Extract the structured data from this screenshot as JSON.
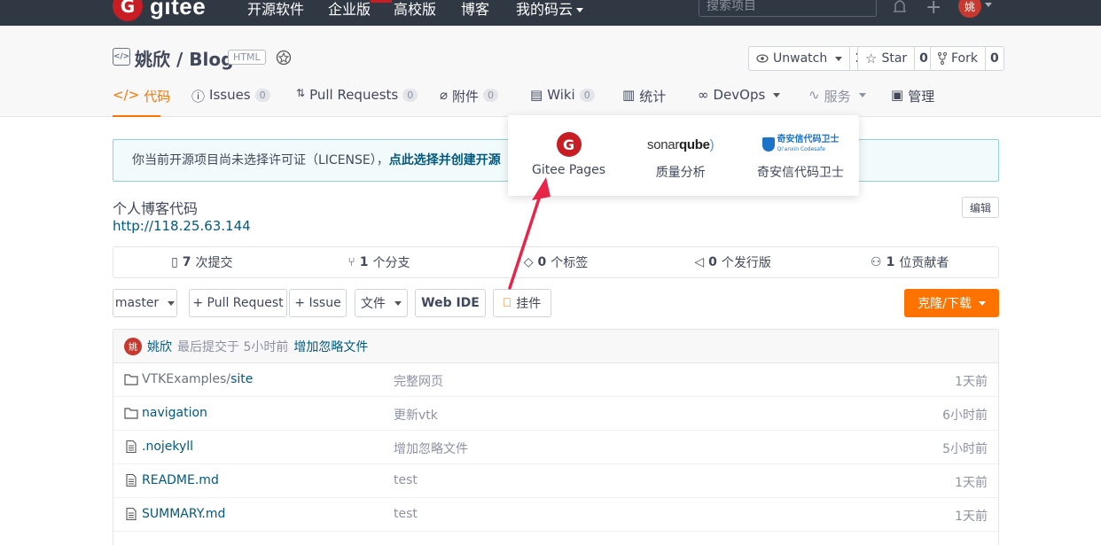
{
  "topnav": {
    "logo_text": "gitee",
    "logo_letter": "G",
    "links": [
      "开源软件",
      "企业版",
      "高校版",
      "博客",
      "我的码云"
    ],
    "search_placeholder": "搜索项目",
    "user_avatar": "姚"
  },
  "repo": {
    "owner_name": "姚欣 / Blog",
    "lang_tag": "HTML",
    "watch_label": "Unwatch",
    "watch_count": "1",
    "star_label": "Star",
    "star_count": "0",
    "fork_label": "Fork",
    "fork_count": "0"
  },
  "tabs": [
    {
      "label": "代码"
    },
    {
      "label": "Issues",
      "count": "0"
    },
    {
      "label": "Pull Requests",
      "count": "0"
    },
    {
      "label": "附件",
      "count": "0"
    },
    {
      "label": "Wiki",
      "count": "0"
    },
    {
      "label": "统计"
    },
    {
      "label": "DevOps"
    },
    {
      "label": "服务"
    },
    {
      "label": "管理"
    }
  ],
  "notice": {
    "text": "你当前开源项目尚未选择许可证（LICENSE），",
    "link": "点此选择并创建开源"
  },
  "description": "个人博客代码",
  "homepage": "http://118.25.63.144",
  "edit_label": "编辑",
  "stats": [
    {
      "num": "7",
      "label": "次提交"
    },
    {
      "num": "1",
      "label": "个分支"
    },
    {
      "num": "0",
      "label": "个标签"
    },
    {
      "num": "0",
      "label": "个发行版"
    },
    {
      "num": "1",
      "label": "位贡献者"
    }
  ],
  "toolbar": {
    "branch": "master",
    "pull_request": "+ Pull Request",
    "issue": "+ Issue",
    "files": "文件",
    "webide": "Web IDE",
    "widget": "挂件",
    "clone": "克隆/下载"
  },
  "last_commit": {
    "avatar": "姚",
    "author": "姚欣",
    "meta": "最后提交于 5小时前",
    "message": "增加忽略文件"
  },
  "files": [
    {
      "dir": "VTKExamples/",
      "name": "site",
      "type": "folder",
      "msg": "完整网页",
      "time": "1天前"
    },
    {
      "dir": "",
      "name": "navigation",
      "type": "folder",
      "msg": "更新vtk",
      "time": "6小时前"
    },
    {
      "dir": "",
      "name": ".nojekyll",
      "type": "file",
      "msg": "增加忽略文件",
      "time": "5小时前"
    },
    {
      "dir": "",
      "name": "README.md",
      "type": "file",
      "msg": "test",
      "time": "1天前"
    },
    {
      "dir": "",
      "name": "SUMMARY.md",
      "type": "file",
      "msg": "test",
      "time": "1天前"
    }
  ],
  "services_dropdown": [
    {
      "label": "Gitee Pages",
      "logo": "G"
    },
    {
      "label": "质量分析",
      "logo_a": "sonar",
      "logo_b": "qube"
    },
    {
      "label": "奇安信代码卫士",
      "logo_text": "奇安信代码卫士",
      "logo_sub": "Qi'anxin Codesafe"
    }
  ],
  "colors": {
    "accent": "#fe7300",
    "nav_bg": "#2f3843",
    "brand_red": "#c71d23",
    "link": "#005980",
    "arrow": "#e8244a"
  }
}
